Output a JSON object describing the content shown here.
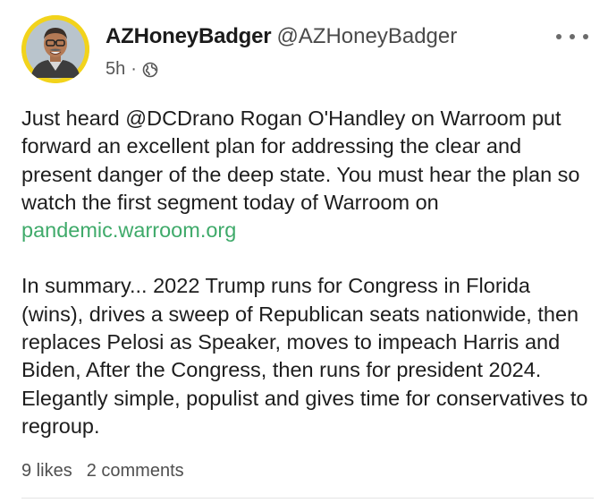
{
  "author": {
    "name": "AZHoneyBadger",
    "handle": "@AZHoneyBadger"
  },
  "meta": {
    "time": "5h",
    "separator": "·",
    "visibility_icon": "globe-icon"
  },
  "more_icon": "more-horizontal-icon",
  "post": {
    "paragraph1_text": "Just heard @DCDrano Rogan O'Handley on Warroom put forward an excellent plan for addressing the clear and present danger of the deep state. You must hear the plan so watch the first segment today of Warroom on ",
    "paragraph1_link": "pandemic.warroom.org",
    "paragraph2_text": "In summary... 2022 Trump runs for Congress in Florida (wins), drives a sweep of Republican seats nationwide, then replaces Pelosi as Speaker, moves to impeach Harris and Biden, After the Congress, then runs for president 2024. Elegantly simple, populist and gives time for conservatives to regroup."
  },
  "engagement": {
    "likes": "9 likes",
    "comments": "2 comments"
  },
  "colors": {
    "link": "#3faa6a",
    "avatar_ring": "#f2d31b"
  }
}
